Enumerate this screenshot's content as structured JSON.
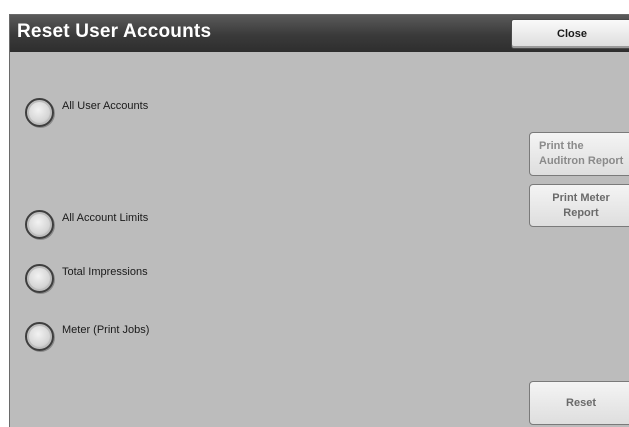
{
  "header": {
    "title": "Reset User Accounts",
    "close_label": "Close"
  },
  "options": [
    {
      "label": "All User Accounts",
      "selected": false
    },
    {
      "label": "All Account Limits",
      "selected": false
    },
    {
      "label": "Total Impressions",
      "selected": false
    },
    {
      "label": "Meter (Print Jobs)",
      "selected": false
    }
  ],
  "side_buttons": {
    "auditron_line1": "Print the",
    "auditron_line2": "Auditron Report",
    "meter_line1": "Print Meter",
    "meter_line2": "Report",
    "reset_label": "Reset"
  },
  "colors": {
    "panel_bg": "#bcbcbc",
    "titlebar": "#3a3a3a",
    "disabled_text": "#8a8a8a"
  }
}
